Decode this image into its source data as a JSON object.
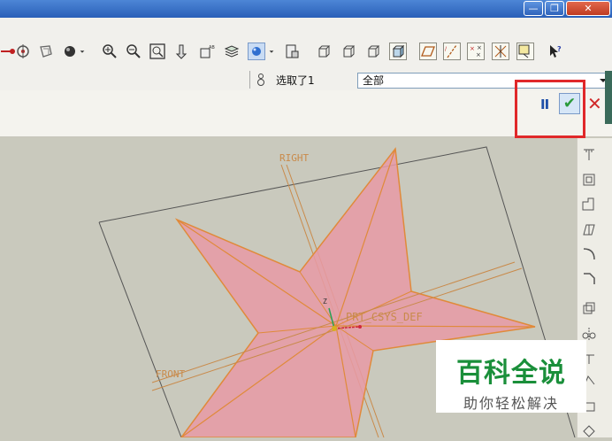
{
  "window": {
    "minimize_glyph": "—",
    "restore_glyph": "❐",
    "close_glyph": "✕"
  },
  "toolbar": {
    "icons": [
      "redraw-icon",
      "spin-center-icon",
      "orient-icon",
      "shading-icon",
      "zoom-in-icon",
      "zoom-out-icon",
      "refit-icon",
      "datum-plane-icon",
      "datum-axis-icon",
      "layers-icon",
      "display-style-icon",
      "saved-views-icon",
      "wireframe-icon",
      "hidden-line-icon",
      "no-hidden-icon",
      "shaded-icon",
      "plane-display-icon",
      "axis-display-icon",
      "point-display-icon",
      "csys-display-icon",
      "annotation-display-icon",
      "whats-this-icon"
    ]
  },
  "filter": {
    "selection_status": "选取了1",
    "filter_value": "全部"
  },
  "dashboard": {
    "pause_label": "II",
    "confirm_glyph": "✔",
    "cancel_glyph": "✕"
  },
  "viewport": {
    "datum_right_label": "RIGHT",
    "datum_front_label": "FRONT",
    "csys_label": "PRT_CSYS_DEF",
    "axis_z_label": "Z"
  },
  "right_toolbar": {
    "icons": [
      "hole-icon",
      "shell-icon",
      "rib-icon",
      "draft-icon",
      "round-icon",
      "chamfer-icon",
      "pattern-icon",
      "mirror-icon",
      "merge-icon",
      "trim-icon",
      "offset-icon",
      "thicken-icon"
    ]
  },
  "watermark": {
    "title": "百科全说",
    "subtitle": "助你轻松解决"
  },
  "colors": {
    "star_fill": "#e79aa6",
    "star_edge": "#e08a3a",
    "datum_color": "#c98a4a",
    "highlight_red": "#e0282a",
    "confirm_green": "#2a9a3a"
  }
}
